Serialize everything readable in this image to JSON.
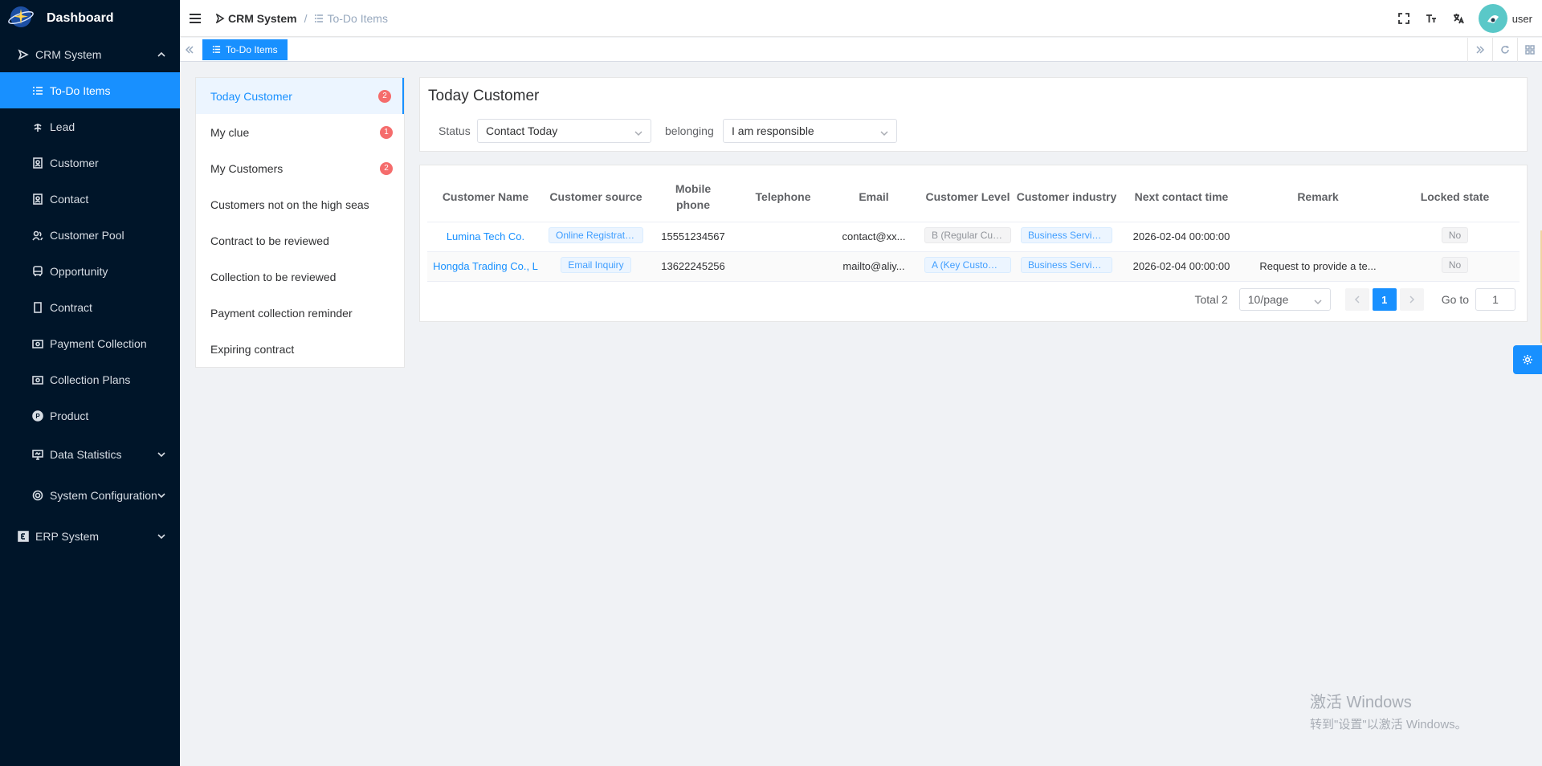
{
  "brand": {
    "title": "Dashboard"
  },
  "sidebar": {
    "items": [
      {
        "label": "CRM System",
        "level": "top",
        "expanded": true
      },
      {
        "label": "To-Do Items",
        "level": "sub",
        "active": true
      },
      {
        "label": "Lead",
        "level": "sub"
      },
      {
        "label": "Customer",
        "level": "sub"
      },
      {
        "label": "Contact",
        "level": "sub"
      },
      {
        "label": "Customer Pool",
        "level": "sub"
      },
      {
        "label": "Opportunity",
        "level": "sub"
      },
      {
        "label": "Contract",
        "level": "sub"
      },
      {
        "label": "Payment Collection",
        "level": "sub"
      },
      {
        "label": "Collection Plans",
        "level": "sub"
      },
      {
        "label": "Product",
        "level": "sub"
      },
      {
        "label": "Data Statistics",
        "level": "sub"
      },
      {
        "label": "System Configuration",
        "level": "sub"
      },
      {
        "label": "ERP System",
        "level": "top"
      }
    ]
  },
  "header": {
    "breadcrumb": [
      "CRM System",
      "To-Do Items"
    ],
    "user": "user"
  },
  "tags": {
    "active": "To-Do Items"
  },
  "todo": {
    "items": [
      {
        "label": "Today Customer",
        "badge": "2"
      },
      {
        "label": "My clue",
        "badge": "1"
      },
      {
        "label": "My Customers",
        "badge": "2"
      },
      {
        "label": "Customers not on the high seas",
        "badge": ""
      },
      {
        "label": "Contract to be reviewed",
        "badge": ""
      },
      {
        "label": "Collection to be reviewed",
        "badge": ""
      },
      {
        "label": "Payment collection reminder",
        "badge": ""
      },
      {
        "label": "Expiring contract",
        "badge": ""
      }
    ]
  },
  "filter": {
    "title": "Today Customer",
    "status_label": "Status",
    "status_value": "Contact Today",
    "belonging_label": "belonging",
    "belonging_value": "I am responsible"
  },
  "table": {
    "columns": [
      "Customer Name",
      "Customer source",
      "Mobile phone",
      "Telephone",
      "Email",
      "Customer Level",
      "Customer industry",
      "Next contact time",
      "Remark",
      "Locked state"
    ],
    "rows": [
      {
        "name": "Lumina Tech Co.",
        "source": "Online Registration",
        "mobile": "15551234567",
        "telephone": "",
        "email": "contact@xx...",
        "level": "B (Regular Customer)",
        "industry": "Business Services",
        "next": "2026-02-04 00:00:00",
        "remark": "",
        "locked": "No"
      },
      {
        "name": "Hongda Trading Co., L",
        "source": "Email Inquiry",
        "mobile": "13622245256",
        "telephone": "",
        "email": "mailto@aliy...",
        "level": "A (Key Customer)",
        "industry": "Business Services",
        "next": "2026-02-04 00:00:00",
        "remark": "Request to provide a te...",
        "locked": "No"
      }
    ]
  },
  "pagination": {
    "total": "Total 2",
    "page_size": "10/page",
    "current": "1",
    "goto_label": "Go to",
    "goto_value": "1"
  },
  "watermark": {
    "line1": "激活 Windows",
    "line2": "转到\"设置\"以激活 Windows。"
  },
  "colors": {
    "accent": "#1890ff",
    "sidebar_bg": "#001529",
    "badge": "#f56c6c"
  }
}
